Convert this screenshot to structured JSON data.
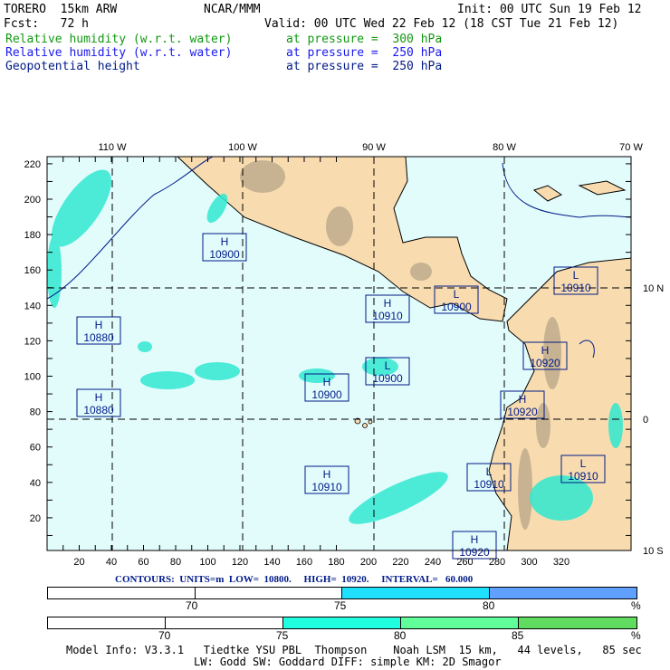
{
  "header": {
    "model": "TORERO  15km ARW",
    "org": "NCAR/MMM",
    "init": "Init: 00 UTC Sun 19 Feb 12",
    "fcst": "Fcst:   72 h",
    "valid": "Valid: 00 UTC Wed 22 Feb 12 (18 CST Tue 21 Feb 12)"
  },
  "fields": [
    {
      "name": "Relative humidity (w.r.t. water)",
      "level": "at pressure =  300 hPa",
      "color": "#119911"
    },
    {
      "name": "Relative humidity (w.r.t. water)",
      "level": "at pressure =  250 hPa",
      "color": "#1a1aee"
    },
    {
      "name": "Geopotential height",
      "level": "at pressure =  250 hPa",
      "color": "#001a88"
    }
  ],
  "map": {
    "top_labels": [
      "110 W",
      "100 W",
      "90 W",
      "80 W",
      "70 W"
    ],
    "right_labels": [
      "10 N",
      "0",
      "10 S"
    ],
    "x_ticks": [
      "20",
      "40",
      "60",
      "80",
      "100",
      "120",
      "140",
      "160",
      "180",
      "200",
      "220",
      "240",
      "260",
      "280",
      "300",
      "320"
    ],
    "y_ticks": [
      "20",
      "40",
      "60",
      "80",
      "100",
      "120",
      "140",
      "160",
      "180",
      "200",
      "220"
    ],
    "centers": [
      {
        "type": "H",
        "value": "10900"
      },
      {
        "type": "H",
        "value": "10910"
      },
      {
        "type": "L",
        "value": "10900"
      },
      {
        "type": "L",
        "value": "10910"
      },
      {
        "type": "H",
        "value": "10880"
      },
      {
        "type": "H",
        "value": "10920"
      },
      {
        "type": "H",
        "value": "10900"
      },
      {
        "type": "L",
        "value": "10900"
      },
      {
        "type": "H",
        "value": "10880"
      },
      {
        "type": "H",
        "value": "10920"
      },
      {
        "type": "L",
        "value": "10910"
      },
      {
        "type": "L",
        "value": "10910"
      },
      {
        "type": "H",
        "value": "10910"
      },
      {
        "type": "H",
        "value": "10920"
      }
    ]
  },
  "contours": "CONTOURS:  UNITS=m  LOW=  10800.     HIGH=  10920.     INTERVAL=   60.000",
  "legend1": {
    "labels": [
      "70",
      "75",
      "80",
      "%"
    ],
    "colors": [
      "#ffffff",
      "#ffffff",
      "#20e0ff",
      "#60a0ff"
    ]
  },
  "legend2": {
    "labels": [
      "70",
      "75",
      "80",
      "85",
      "%"
    ],
    "colors": [
      "#ffffff",
      "#ffffff",
      "#20ffe0",
      "#60ff9a",
      "#60dd60"
    ]
  },
  "footer": {
    "line1": "Model Info: V3.3.1   Tiedtke YSU PBL  Thompson    Noah LSM  15 km,   44 levels,   85 sec",
    "line2": "LW: Godd SW: Goddard DIFF: simple KM: 2D Smagor"
  }
}
